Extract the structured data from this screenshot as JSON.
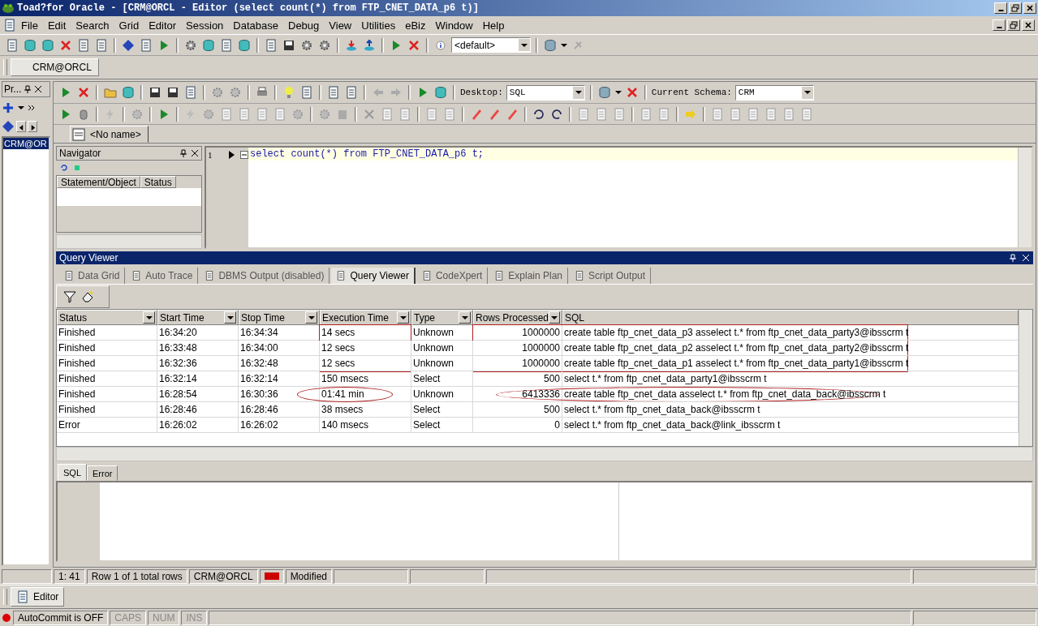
{
  "window": {
    "title": "Toad?for Oracle - [CRM@ORCL - Editor (select count(*) from FTP_CNET_DATA_p6 t)]"
  },
  "menu": [
    "File",
    "Edit",
    "Search",
    "Grid",
    "Editor",
    "Session",
    "Database",
    "Debug",
    "View",
    "Utilities",
    "eBiz",
    "Window",
    "Help"
  ],
  "main_toolbar": {
    "dropdown_value": "<default>"
  },
  "connection_tabs": [
    {
      "label": "CRM@ORCL",
      "selected": true
    }
  ],
  "left_panel": {
    "title": "Pr...",
    "items": [
      {
        "label": "CRM@OR",
        "selected": true
      }
    ]
  },
  "editor_toolbar": {
    "desktop_label": "Desktop:",
    "desktop_value": "SQL",
    "schema_label": "Current Schema:",
    "schema_value": "CRM"
  },
  "editor_tabs": [
    {
      "label": "<No name>",
      "selected": true
    }
  ],
  "navigator": {
    "title": "Navigator",
    "columns": [
      "Statement/Object",
      "Status"
    ]
  },
  "editor": {
    "lines": [
      {
        "number": "1",
        "text": "select count(*) from FTP_CNET_DATA_p6 t;"
      }
    ]
  },
  "query_viewer": {
    "title": "Query Viewer",
    "tabs": [
      {
        "label": "Data Grid",
        "selected": false
      },
      {
        "label": "Auto Trace",
        "selected": false
      },
      {
        "label": "DBMS Output (disabled)",
        "selected": false
      },
      {
        "label": "Query Viewer",
        "selected": true
      },
      {
        "label": "CodeXpert",
        "selected": false
      },
      {
        "label": "Explain Plan",
        "selected": false
      },
      {
        "label": "Script Output",
        "selected": false
      }
    ],
    "columns": [
      "Status",
      "Start Time",
      "Stop Time",
      "Execution Time",
      "Type",
      "Rows Processed",
      "SQL"
    ],
    "rows": [
      {
        "status": "Finished",
        "start": "16:34:20",
        "stop": "16:34:34",
        "execution_time": "14 secs",
        "type": "Unknown",
        "rows_processed": "1000000",
        "sql": "create table ftp_cnet_data_p3 asselect t.* from ftp_cnet_data_party3@ibsscrm t",
        "boxed": true,
        "circled": false
      },
      {
        "status": "Finished",
        "start": "16:33:48",
        "stop": "16:34:00",
        "execution_time": "12 secs",
        "type": "Unknown",
        "rows_processed": "1000000",
        "sql": "create table ftp_cnet_data_p2 asselect t.* from ftp_cnet_data_party2@ibsscrm t",
        "boxed": true,
        "circled": false
      },
      {
        "status": "Finished",
        "start": "16:32:36",
        "stop": "16:32:48",
        "execution_time": "12 secs",
        "type": "Unknown",
        "rows_processed": "1000000",
        "sql": "create table ftp_cnet_data_p1 asselect t.* from ftp_cnet_data_party1@ibsscrm t",
        "boxed": true,
        "circled": false
      },
      {
        "status": "Finished",
        "start": "16:32:14",
        "stop": "16:32:14",
        "execution_time": "150 msecs",
        "type": "Select",
        "rows_processed": "500",
        "sql": "select t.* from ftp_cnet_data_party1@ibsscrm t",
        "boxed": false,
        "circled": false
      },
      {
        "status": "Finished",
        "start": "16:28:54",
        "stop": "16:30:36",
        "execution_time": "01:41 min",
        "type": "Unknown",
        "rows_processed": "6413336",
        "sql": "create table ftp_cnet_data asselect t.* from ftp_cnet_data_back@ibsscrm t",
        "boxed": false,
        "circled": true
      },
      {
        "status": "Finished",
        "start": "16:28:46",
        "stop": "16:28:46",
        "execution_time": "38 msecs",
        "type": "Select",
        "rows_processed": "500",
        "sql": "select t.* from ftp_cnet_data_back@ibsscrm t",
        "boxed": false,
        "circled": false
      },
      {
        "status": "Error",
        "start": "16:26:02",
        "stop": "16:26:02",
        "execution_time": "140 msecs",
        "type": "Select",
        "rows_processed": "0",
        "sql": "select t.* from ftp_cnet_data_back@link_ibsscrm t",
        "boxed": false,
        "circled": false
      }
    ]
  },
  "detail_tabs": [
    {
      "label": "SQL",
      "selected": true
    },
    {
      "label": "Error",
      "selected": false
    }
  ],
  "status_bar": [
    "1:  41",
    "Row 1 of 1 total rows",
    "CRM@ORCL",
    "Modified"
  ],
  "taskbar": [
    {
      "label": "Editor",
      "selected": true
    }
  ],
  "bottom_status": [
    {
      "label": "AutoCommit is OFF",
      "disabled": false
    },
    {
      "label": "CAPS",
      "disabled": true
    },
    {
      "label": "NUM",
      "disabled": true
    },
    {
      "label": "INS",
      "disabled": true
    }
  ]
}
